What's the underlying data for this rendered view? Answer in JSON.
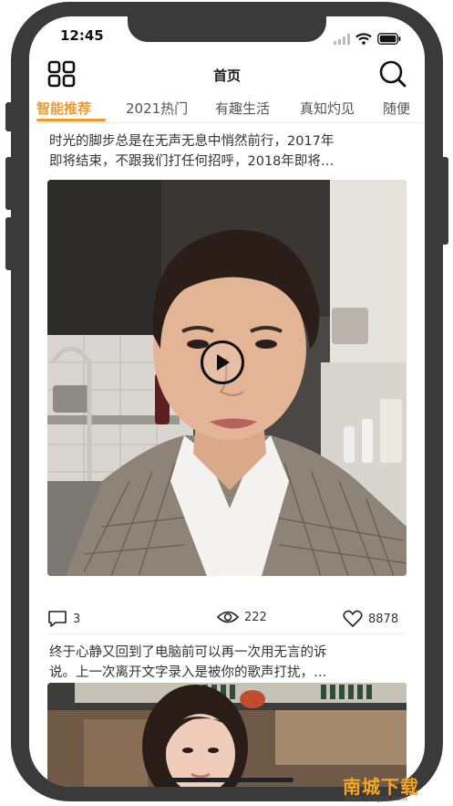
{
  "status_bar": {
    "time": "12:45"
  },
  "header": {
    "title": "首页"
  },
  "tabs": [
    {
      "label": "智能推荐",
      "active": true
    },
    {
      "label": "2021热门"
    },
    {
      "label": "有趣生活"
    },
    {
      "label": "真知灼见"
    },
    {
      "label": "随便"
    }
  ],
  "posts": [
    {
      "text_line1": "时光的脚步总是在无声无息中悄然前行，2017年",
      "text_line2": "即将结束，不跟我们打任何招呼，2018年即将…",
      "comments": "3",
      "views": "222",
      "likes": "8878",
      "media_type": "video"
    },
    {
      "text_line1": "终于心静又回到了电脑前可以再一次用无言的诉",
      "text_line2": "说。上一次离开文字录入是被你的歌声打扰，…",
      "media_type": "image"
    }
  ],
  "watermark": {
    "main": "南城下载",
    "sub": "www.nccgcc.com"
  },
  "colors": {
    "accent": "#f09a2c",
    "frame": "#3a3a3a"
  }
}
